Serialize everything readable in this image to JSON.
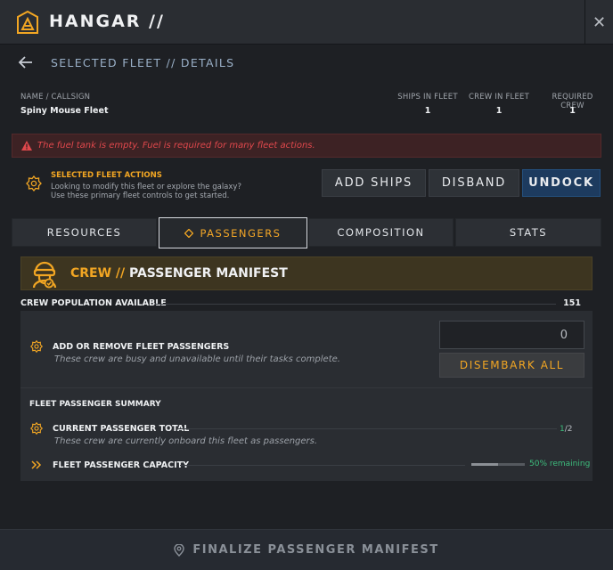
{
  "window": {
    "title": "HANGAR //",
    "close_glyph": "✕"
  },
  "nav": {
    "back_label": "SELECTED FLEET // DETAILS"
  },
  "fleet_info": {
    "name_label": "NAME / CALLSIGN",
    "name_value": "Spiny Mouse Fleet",
    "ships_label": "SHIPS IN FLEET",
    "ships_value": "1",
    "crew_label": "CREW IN FLEET",
    "crew_value": "1",
    "required_label": "REQUIRED CREW",
    "required_value": "1"
  },
  "alert": {
    "text": "The fuel tank is empty. Fuel is required for many fleet actions."
  },
  "actions": {
    "title": "SELECTED FLEET ACTIONS",
    "desc_line1": "Looking to modify this fleet or explore the galaxy?",
    "desc_line2": "Use these primary fleet controls to get started.",
    "add_ships": "ADD SHIPS",
    "disband": "DISBAND",
    "undock": "UNDOCK"
  },
  "tabs": [
    {
      "label": "RESOURCES"
    },
    {
      "label": "PASSENGERS"
    },
    {
      "label": "COMPOSITION"
    },
    {
      "label": "STATS"
    }
  ],
  "manifest": {
    "tag": "CREW //",
    "title": "PASSENGER MANIFEST",
    "population_label": "CREW POPULATION AVAILABLE",
    "population_value": "151",
    "add_remove_title": "ADD OR REMOVE FLEET PASSENGERS",
    "add_remove_desc": "These crew are busy and unavailable until their tasks complete.",
    "quantity_value": "0",
    "disembark_label": "DISEMBARK ALL",
    "summary_title": "FLEET PASSENGER SUMMARY",
    "current_total_title": "CURRENT PASSENGER TOTAL",
    "current_total_desc": "These crew are currently onboard this fleet as passengers.",
    "current_total_count": "1",
    "current_total_sep": "/",
    "current_total_max": "2",
    "capacity_title": "FLEET PASSENGER CAPACITY",
    "capacity_text": "50% remaining",
    "capacity_fraction": 0.5
  },
  "footer": {
    "label": "FINALIZE PASSENGER MANIFEST"
  },
  "colors": {
    "accent": "#f2a623",
    "primary": "#1d3b5f",
    "alert": "#e0484c",
    "success": "#3dbd7d"
  },
  "icons": [
    "hangar-emblem-icon",
    "close-icon",
    "back-arrow-icon",
    "warning-icon",
    "gear-icon",
    "diamond-icon",
    "crew-helmet-icon",
    "chevron-double-right-icon",
    "location-pin-icon"
  ]
}
